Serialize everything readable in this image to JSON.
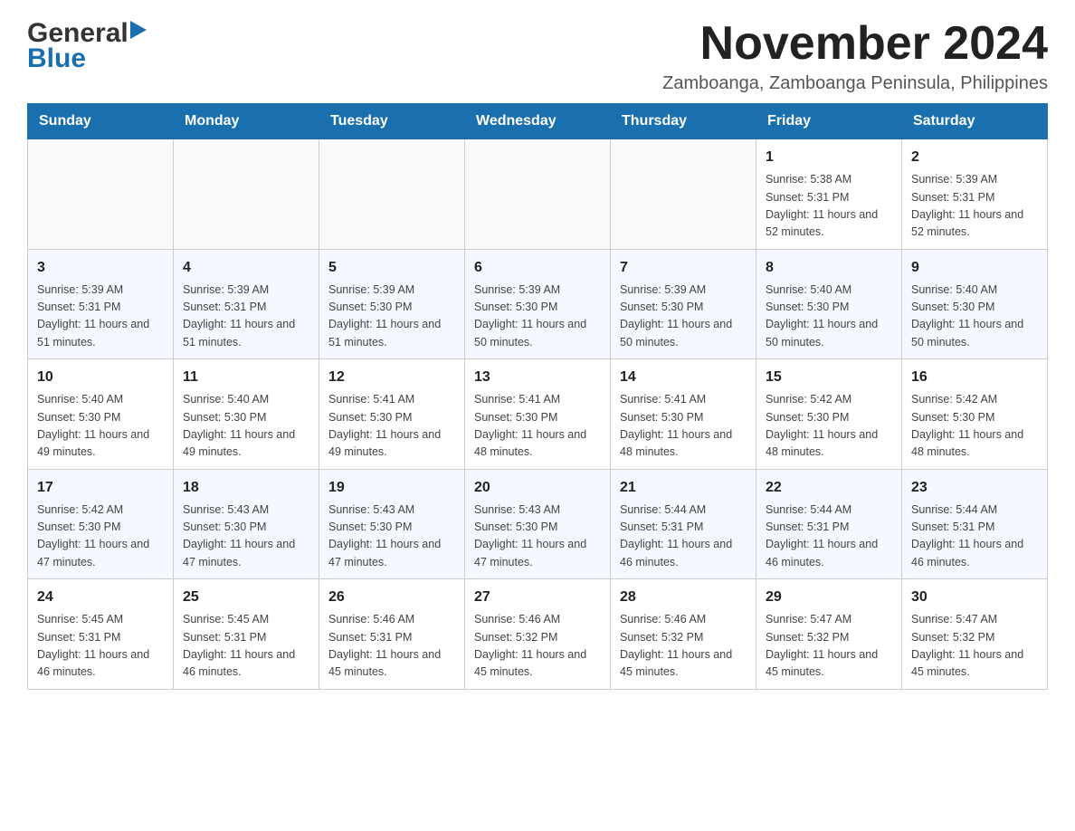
{
  "logo": {
    "general_text": "General",
    "blue_text": "Blue"
  },
  "header": {
    "month_year": "November 2024",
    "location": "Zamboanga, Zamboanga Peninsula, Philippines"
  },
  "days_of_week": [
    "Sunday",
    "Monday",
    "Tuesday",
    "Wednesday",
    "Thursday",
    "Friday",
    "Saturday"
  ],
  "weeks": [
    [
      {
        "day": "",
        "info": ""
      },
      {
        "day": "",
        "info": ""
      },
      {
        "day": "",
        "info": ""
      },
      {
        "day": "",
        "info": ""
      },
      {
        "day": "",
        "info": ""
      },
      {
        "day": "1",
        "info": "Sunrise: 5:38 AM\nSunset: 5:31 PM\nDaylight: 11 hours and 52 minutes."
      },
      {
        "day": "2",
        "info": "Sunrise: 5:39 AM\nSunset: 5:31 PM\nDaylight: 11 hours and 52 minutes."
      }
    ],
    [
      {
        "day": "3",
        "info": "Sunrise: 5:39 AM\nSunset: 5:31 PM\nDaylight: 11 hours and 51 minutes."
      },
      {
        "day": "4",
        "info": "Sunrise: 5:39 AM\nSunset: 5:31 PM\nDaylight: 11 hours and 51 minutes."
      },
      {
        "day": "5",
        "info": "Sunrise: 5:39 AM\nSunset: 5:30 PM\nDaylight: 11 hours and 51 minutes."
      },
      {
        "day": "6",
        "info": "Sunrise: 5:39 AM\nSunset: 5:30 PM\nDaylight: 11 hours and 50 minutes."
      },
      {
        "day": "7",
        "info": "Sunrise: 5:39 AM\nSunset: 5:30 PM\nDaylight: 11 hours and 50 minutes."
      },
      {
        "day": "8",
        "info": "Sunrise: 5:40 AM\nSunset: 5:30 PM\nDaylight: 11 hours and 50 minutes."
      },
      {
        "day": "9",
        "info": "Sunrise: 5:40 AM\nSunset: 5:30 PM\nDaylight: 11 hours and 50 minutes."
      }
    ],
    [
      {
        "day": "10",
        "info": "Sunrise: 5:40 AM\nSunset: 5:30 PM\nDaylight: 11 hours and 49 minutes."
      },
      {
        "day": "11",
        "info": "Sunrise: 5:40 AM\nSunset: 5:30 PM\nDaylight: 11 hours and 49 minutes."
      },
      {
        "day": "12",
        "info": "Sunrise: 5:41 AM\nSunset: 5:30 PM\nDaylight: 11 hours and 49 minutes."
      },
      {
        "day": "13",
        "info": "Sunrise: 5:41 AM\nSunset: 5:30 PM\nDaylight: 11 hours and 48 minutes."
      },
      {
        "day": "14",
        "info": "Sunrise: 5:41 AM\nSunset: 5:30 PM\nDaylight: 11 hours and 48 minutes."
      },
      {
        "day": "15",
        "info": "Sunrise: 5:42 AM\nSunset: 5:30 PM\nDaylight: 11 hours and 48 minutes."
      },
      {
        "day": "16",
        "info": "Sunrise: 5:42 AM\nSunset: 5:30 PM\nDaylight: 11 hours and 48 minutes."
      }
    ],
    [
      {
        "day": "17",
        "info": "Sunrise: 5:42 AM\nSunset: 5:30 PM\nDaylight: 11 hours and 47 minutes."
      },
      {
        "day": "18",
        "info": "Sunrise: 5:43 AM\nSunset: 5:30 PM\nDaylight: 11 hours and 47 minutes."
      },
      {
        "day": "19",
        "info": "Sunrise: 5:43 AM\nSunset: 5:30 PM\nDaylight: 11 hours and 47 minutes."
      },
      {
        "day": "20",
        "info": "Sunrise: 5:43 AM\nSunset: 5:30 PM\nDaylight: 11 hours and 47 minutes."
      },
      {
        "day": "21",
        "info": "Sunrise: 5:44 AM\nSunset: 5:31 PM\nDaylight: 11 hours and 46 minutes."
      },
      {
        "day": "22",
        "info": "Sunrise: 5:44 AM\nSunset: 5:31 PM\nDaylight: 11 hours and 46 minutes."
      },
      {
        "day": "23",
        "info": "Sunrise: 5:44 AM\nSunset: 5:31 PM\nDaylight: 11 hours and 46 minutes."
      }
    ],
    [
      {
        "day": "24",
        "info": "Sunrise: 5:45 AM\nSunset: 5:31 PM\nDaylight: 11 hours and 46 minutes."
      },
      {
        "day": "25",
        "info": "Sunrise: 5:45 AM\nSunset: 5:31 PM\nDaylight: 11 hours and 46 minutes."
      },
      {
        "day": "26",
        "info": "Sunrise: 5:46 AM\nSunset: 5:31 PM\nDaylight: 11 hours and 45 minutes."
      },
      {
        "day": "27",
        "info": "Sunrise: 5:46 AM\nSunset: 5:32 PM\nDaylight: 11 hours and 45 minutes."
      },
      {
        "day": "28",
        "info": "Sunrise: 5:46 AM\nSunset: 5:32 PM\nDaylight: 11 hours and 45 minutes."
      },
      {
        "day": "29",
        "info": "Sunrise: 5:47 AM\nSunset: 5:32 PM\nDaylight: 11 hours and 45 minutes."
      },
      {
        "day": "30",
        "info": "Sunrise: 5:47 AM\nSunset: 5:32 PM\nDaylight: 11 hours and 45 minutes."
      }
    ]
  ]
}
